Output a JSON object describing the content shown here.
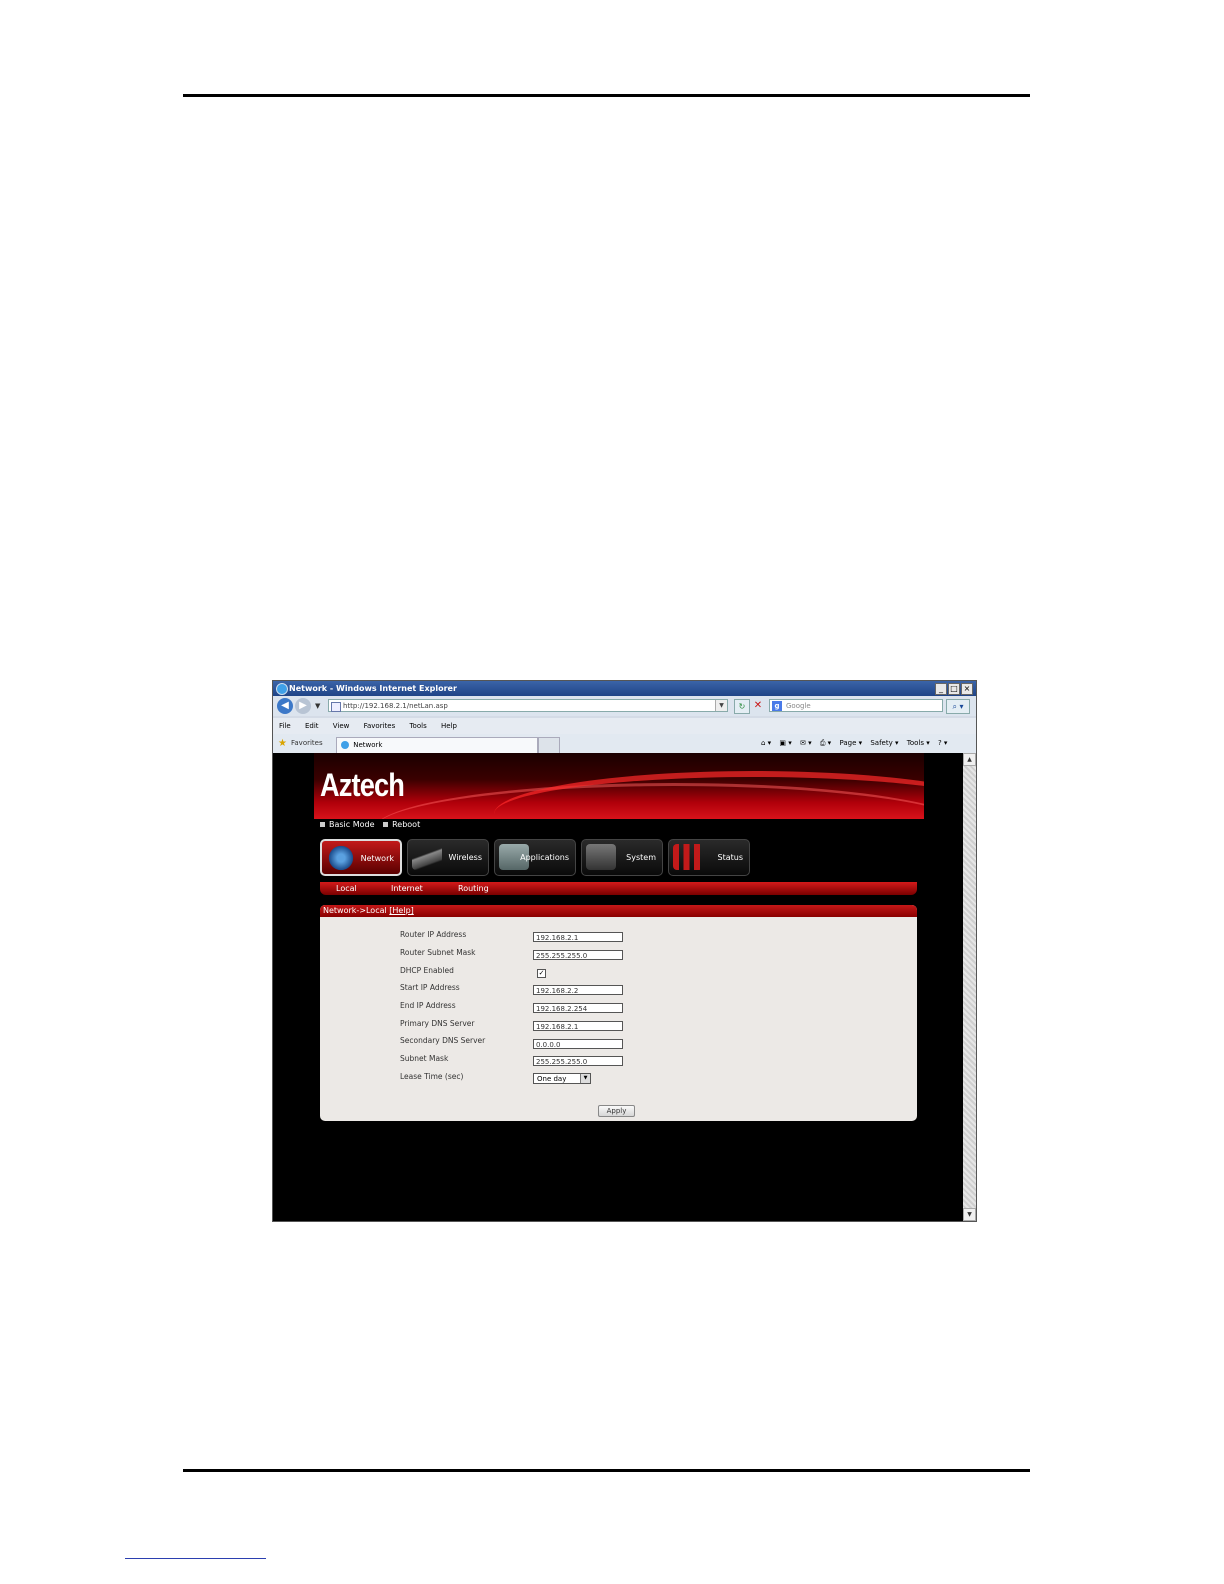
{
  "window": {
    "title": "Network - Windows Internet Explorer",
    "controls": [
      "_",
      "□",
      "×"
    ]
  },
  "addressbar": {
    "url": "http://192.168.2.1/netLan.asp",
    "search_placeholder": "Google"
  },
  "menubar": {
    "items": [
      "File",
      "Edit",
      "View",
      "Favorites",
      "Tools",
      "Help"
    ]
  },
  "favoritesbar": {
    "favorites_label": "Favorites",
    "tab_label": "Network",
    "commands": [
      "Page ▾",
      "Safety ▾",
      "Tools ▾"
    ]
  },
  "router": {
    "logo": "Aztech",
    "quick_links": [
      "Basic Mode",
      "Reboot"
    ],
    "main_tabs": [
      {
        "label": "Network",
        "active": true
      },
      {
        "label": "Wireless",
        "active": false
      },
      {
        "label": "Applications",
        "active": false
      },
      {
        "label": "System",
        "active": false
      },
      {
        "label": "Status",
        "active": false
      }
    ],
    "sub_tabs": [
      "Local",
      "Internet",
      "Routing"
    ],
    "panel_title": "Network->Local",
    "help_link": "[Help]",
    "fields": [
      {
        "label": "Router IP Address",
        "value": "192.168.2.1"
      },
      {
        "label": "Router Subnet Mask",
        "value": "255.255.255.0"
      },
      {
        "label": "DHCP Enabled",
        "value": "✓"
      },
      {
        "label": "Start IP Address",
        "value": "192.168.2.2"
      },
      {
        "label": "End IP Address",
        "value": "192.168.2.254"
      },
      {
        "label": "Primary DNS Server",
        "value": "192.168.2.1"
      },
      {
        "label": "Secondary DNS Server",
        "value": "0.0.0.0"
      },
      {
        "label": "Subnet Mask",
        "value": "255.255.255.0"
      },
      {
        "label": "Lease Time (sec)",
        "value": "One day"
      }
    ],
    "apply_label": "Apply"
  },
  "colors": {
    "brand_red": "#c41818",
    "panel_bg": "#ece9e6"
  }
}
